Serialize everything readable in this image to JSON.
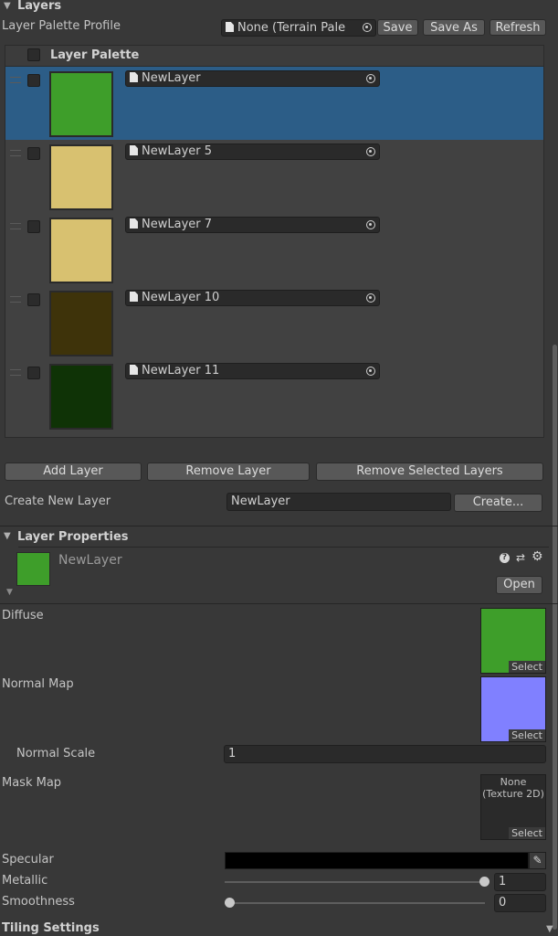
{
  "layers_section": {
    "title": "Layers"
  },
  "profile": {
    "label": "Layer Palette Profile",
    "value": "None (Terrain Pale",
    "save": "Save",
    "save_as": "Save As",
    "refresh": "Refresh"
  },
  "palette": {
    "title": "Layer Palette",
    "layers": [
      {
        "name": "NewLayer",
        "color": "#3e9e2a",
        "selected": true
      },
      {
        "name": "NewLayer 5",
        "color": "#d8c170",
        "selected": false
      },
      {
        "name": "NewLayer 7",
        "color": "#d8c170",
        "selected": false
      },
      {
        "name": "NewLayer 10",
        "color": "#3e330a",
        "selected": false
      },
      {
        "name": "NewLayer 11",
        "color": "#0f3306",
        "selected": false
      }
    ]
  },
  "actions": {
    "add": "Add Layer",
    "remove": "Remove Layer",
    "remove_selected": "Remove Selected Layers"
  },
  "create": {
    "label": "Create New Layer",
    "value": "NewLayer",
    "button": "Create..."
  },
  "props": {
    "title": "Layer Properties",
    "name": "NewLayer",
    "color": "#3e9e2a",
    "open": "Open",
    "diffuse": {
      "label": "Diffuse",
      "select": "Select",
      "color": "#3e9e2a"
    },
    "normal_map": {
      "label": "Normal Map",
      "select": "Select",
      "color": "#8080ff"
    },
    "normal_scale": {
      "label": "Normal Scale",
      "value": "1"
    },
    "mask_map": {
      "label": "Mask Map",
      "none_line1": "None",
      "none_line2": "(Texture 2D)",
      "select": "Select"
    },
    "specular": {
      "label": "Specular",
      "color": "#000000"
    },
    "metallic": {
      "label": "Metallic",
      "value": "1",
      "level": 1
    },
    "smoothness": {
      "label": "Smoothness",
      "value": "0",
      "level": 0
    },
    "tiling": {
      "label": "Tiling Settings"
    }
  }
}
